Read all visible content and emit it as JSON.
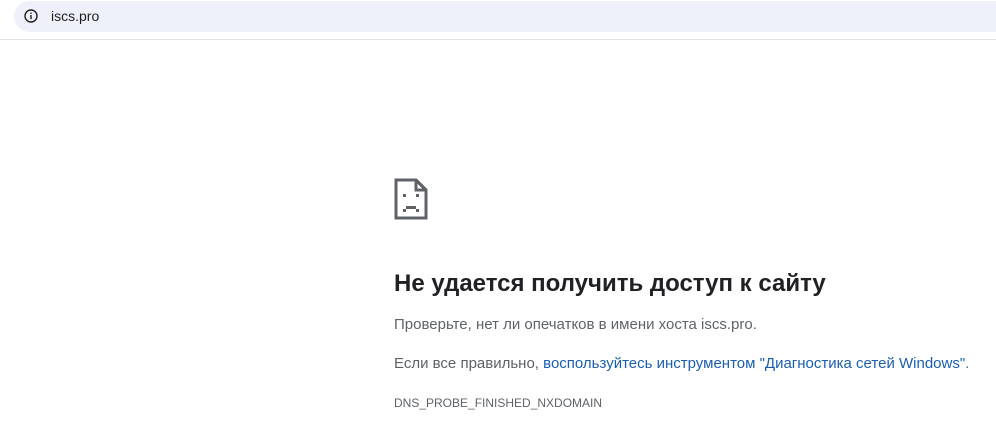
{
  "address_bar": {
    "url": "iscs.pro",
    "site_info_icon": "info-circle-icon"
  },
  "error": {
    "icon": "sad-document-icon",
    "title": "Не удается получить доступ к сайту",
    "line1": "Проверьте, нет ли опечатков в имени хоста iscs.pro.",
    "line2_prefix": "Если все правильно, ",
    "line2_link": "воспользуйтесь инструментом \"Диагностика сетей Windows\"",
    "line2_suffix": ".",
    "code": "DNS_PROBE_FINISHED_NXDOMAIN"
  },
  "colors": {
    "omnibox_bg": "#eef1f9",
    "link": "#1a5fb4",
    "title": "#202124",
    "body_text": "#5f6368"
  }
}
